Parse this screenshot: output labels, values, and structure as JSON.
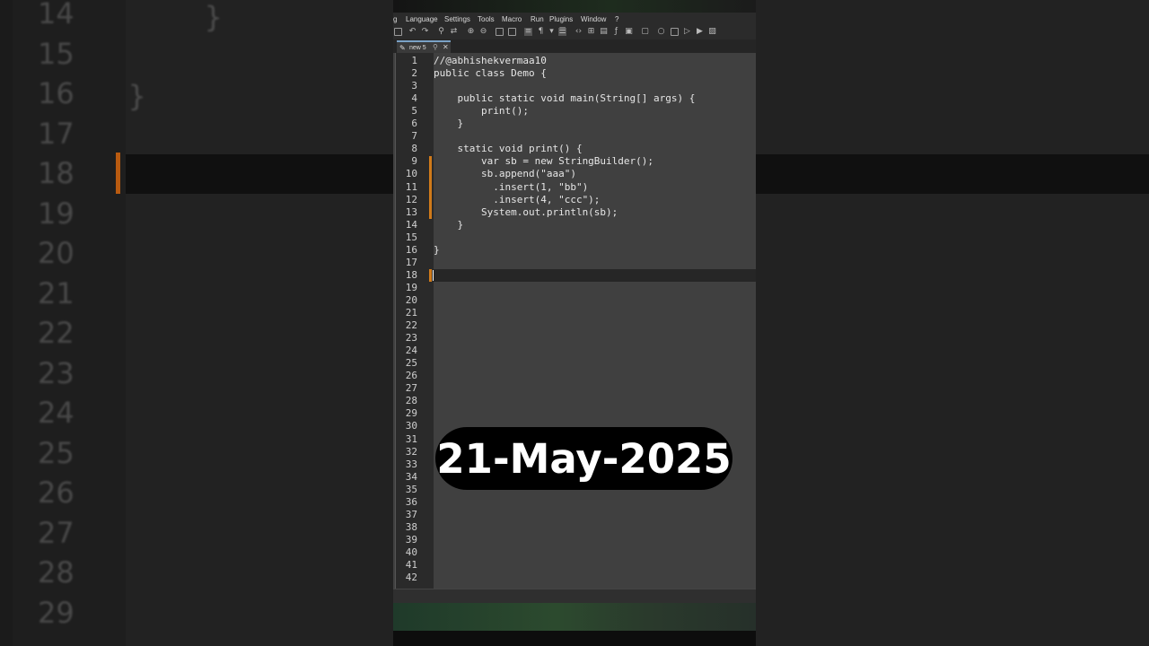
{
  "background": {
    "line_numbers": [
      "14",
      "15",
      "16",
      "17",
      "18",
      "19",
      "20",
      "21",
      "22",
      "23",
      "24",
      "25",
      "26",
      "27",
      "28",
      "29"
    ],
    "braces": [
      "}",
      "}"
    ]
  },
  "menu": {
    "items": [
      "g",
      "Language",
      "Settings",
      "Tools",
      "Macro",
      "Run",
      "Plugins",
      "Window",
      "?"
    ]
  },
  "toolbar": {
    "icons": [
      "close-all-icon",
      "undo-icon",
      "redo-icon",
      "find-icon",
      "replace-icon",
      "zoom-in-icon",
      "zoom-out-icon",
      "sync-v-icon",
      "sync-h-icon",
      "word-wrap-icon",
      "show-all-chars-icon",
      "indent-guide-icon",
      "xml-icon",
      "doc-map-icon",
      "doc-list-icon",
      "function-list-icon",
      "folder-icon",
      "monitor-icon",
      "record-macro-icon",
      "stop-macro-icon",
      "play-macro-icon",
      "run-macro-icon",
      "save-macro-icon"
    ]
  },
  "tab": {
    "label": "new 5"
  },
  "editor": {
    "line_numbers": [
      "1",
      "2",
      "3",
      "4",
      "5",
      "6",
      "7",
      "8",
      "9",
      "10",
      "11",
      "12",
      "13",
      "14",
      "15",
      "16",
      "17",
      "18",
      "19",
      "20",
      "21",
      "22",
      "23",
      "24",
      "25",
      "26",
      "27",
      "28",
      "29",
      "30",
      "31",
      "32",
      "33",
      "34",
      "35",
      "36",
      "37",
      "38",
      "39",
      "40",
      "41",
      "42"
    ],
    "lines": [
      "//@abhishekvermaa10",
      "public class Demo {",
      "",
      "    public static void main(String[] args) {",
      "        print();",
      "    }",
      "",
      "    static void print() {",
      "        var sb = new StringBuilder();",
      "        sb.append(\"aaa\")",
      "          .insert(1, \"bb\")",
      "          .insert(4, \"ccc\");",
      "        System.out.println(sb);",
      "    }",
      "",
      "}",
      "",
      ""
    ],
    "current_line": 18,
    "colors": {
      "background": "#404040",
      "current_line": "#262626",
      "change_marker": "#d07a1a"
    }
  },
  "overlay": {
    "date": "21-May-2025"
  }
}
